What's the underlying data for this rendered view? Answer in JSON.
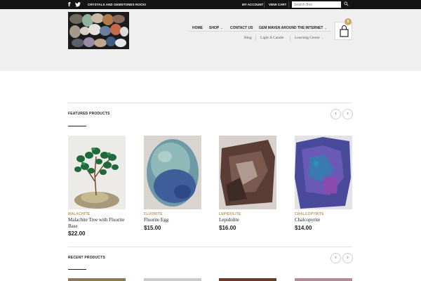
{
  "topbar": {
    "tagline": "CRYSTALS AND GEMSTONES ROCK!",
    "my_account": "MY ACCOUNT",
    "view_cart": "VIEW CART",
    "search_placeholder": "Search Box",
    "social": [
      "facebook-icon",
      "twitter-icon"
    ]
  },
  "nav": {
    "items": [
      {
        "label": "HOME"
      },
      {
        "label": "SHOP"
      },
      {
        "label": "CONTACT US"
      },
      {
        "label": "GEM MAVEN AROUND THE INTERNET"
      }
    ],
    "sub_items": [
      {
        "label": "Blog"
      },
      {
        "label": "Light A Candle"
      },
      {
        "label": "Learning Center"
      }
    ]
  },
  "cart": {
    "count": "0"
  },
  "featured": {
    "title": "FEATURED PRODUCTS",
    "products": [
      {
        "category": "MALACHITE",
        "name": "Malachite Tree with Fluorite Base",
        "price": "$22.00"
      },
      {
        "category": "FLUORITE",
        "name": "Fluorite Egg",
        "price": "$15.00"
      },
      {
        "category": "LEPIDOLITE",
        "name": "Lepidolite",
        "price": "$16.00"
      },
      {
        "category": "CHALCOPYRITE",
        "name": "Chalcopyrite",
        "price": "$14.00"
      }
    ]
  },
  "recent": {
    "title": "RECENT PRODUCTS"
  },
  "colors": {
    "accent": "#c9a96a",
    "category": "#b9995a",
    "topbar": "#141414",
    "header_bg": "#efefef"
  }
}
